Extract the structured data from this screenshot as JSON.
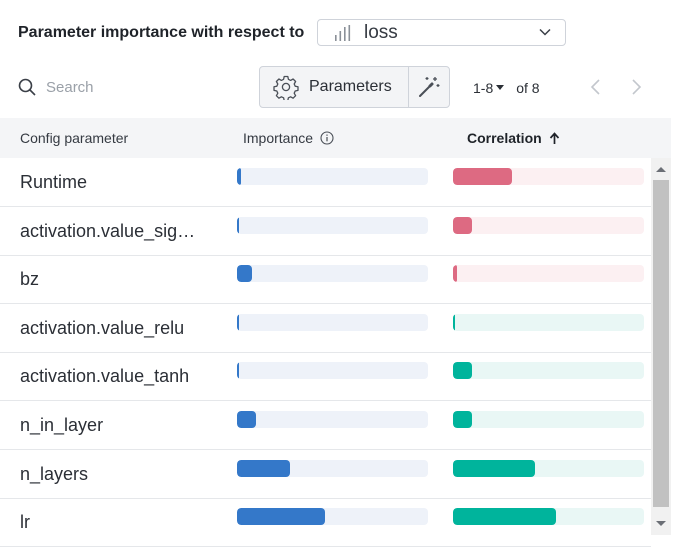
{
  "header": {
    "title": "Parameter importance with respect to",
    "metric": "loss"
  },
  "toolbar": {
    "search_placeholder": "Search",
    "parameters_label": "Parameters",
    "page_range": "1-8",
    "page_total": "of 8"
  },
  "table": {
    "columns": [
      "Config parameter",
      "Importance",
      "Correlation"
    ],
    "colors": {
      "importance_fill": "#3478c9",
      "importance_track": "#eef2f9",
      "positive_fill": "#dd6a82",
      "positive_track": "#fcf0f2",
      "negative_fill": "#00b49c",
      "negative_track": "#e9f7f5"
    },
    "rows": [
      {
        "name": "Runtime",
        "importance": 0.02,
        "correlation": 0.31,
        "sign": "positive"
      },
      {
        "name": "activation.value_sig…",
        "importance": 0.005,
        "correlation": 0.1,
        "sign": "positive"
      },
      {
        "name": "bz",
        "importance": 0.08,
        "correlation": 0.02,
        "sign": "positive"
      },
      {
        "name": "activation.value_relu",
        "importance": 0.01,
        "correlation": 0.005,
        "sign": "negative"
      },
      {
        "name": "activation.value_tanh",
        "importance": 0.01,
        "correlation": 0.1,
        "sign": "negative"
      },
      {
        "name": "n_in_layer",
        "importance": 0.1,
        "correlation": 0.1,
        "sign": "negative"
      },
      {
        "name": "n_layers",
        "importance": 0.28,
        "correlation": 0.43,
        "sign": "negative"
      },
      {
        "name": "lr",
        "importance": 0.46,
        "correlation": 0.54,
        "sign": "negative"
      }
    ]
  }
}
